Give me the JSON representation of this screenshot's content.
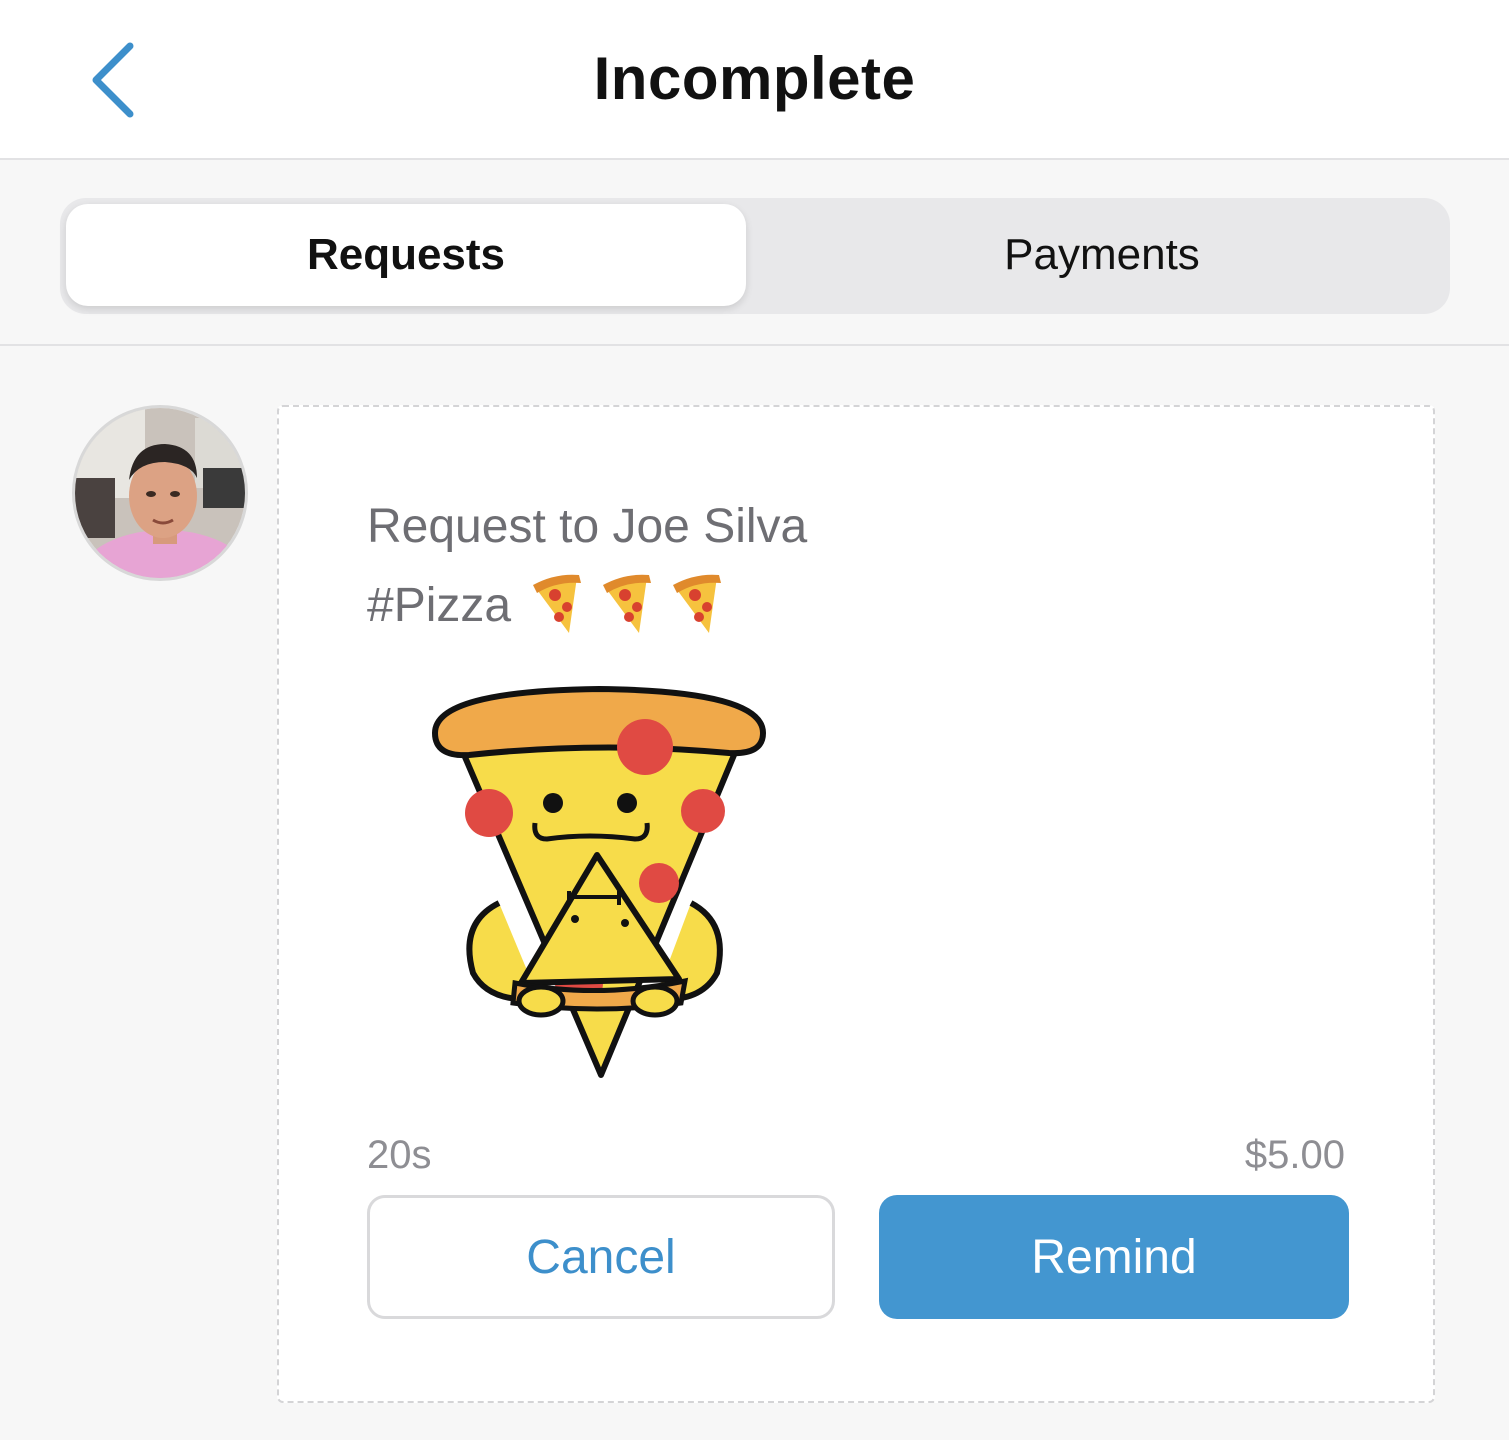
{
  "header": {
    "title": "Incomplete",
    "back_icon": "chevron-left-icon"
  },
  "tabs": [
    {
      "label": "Requests",
      "selected": true
    },
    {
      "label": "Payments",
      "selected": false
    }
  ],
  "request": {
    "title": "Request to Joe Silva",
    "note": "#Pizza",
    "note_emoji_count": 3,
    "note_emoji": "pizza-slice-icon",
    "sticker": "pizza-eating-sticker",
    "avatar": "user-avatar",
    "time": "20s",
    "amount": "$5.00",
    "cancel_label": "Cancel",
    "remind_label": "Remind"
  },
  "colors": {
    "accent": "#4396d0",
    "back_chevron": "#3d8fcb",
    "secondary_text": "#6e6e73"
  }
}
